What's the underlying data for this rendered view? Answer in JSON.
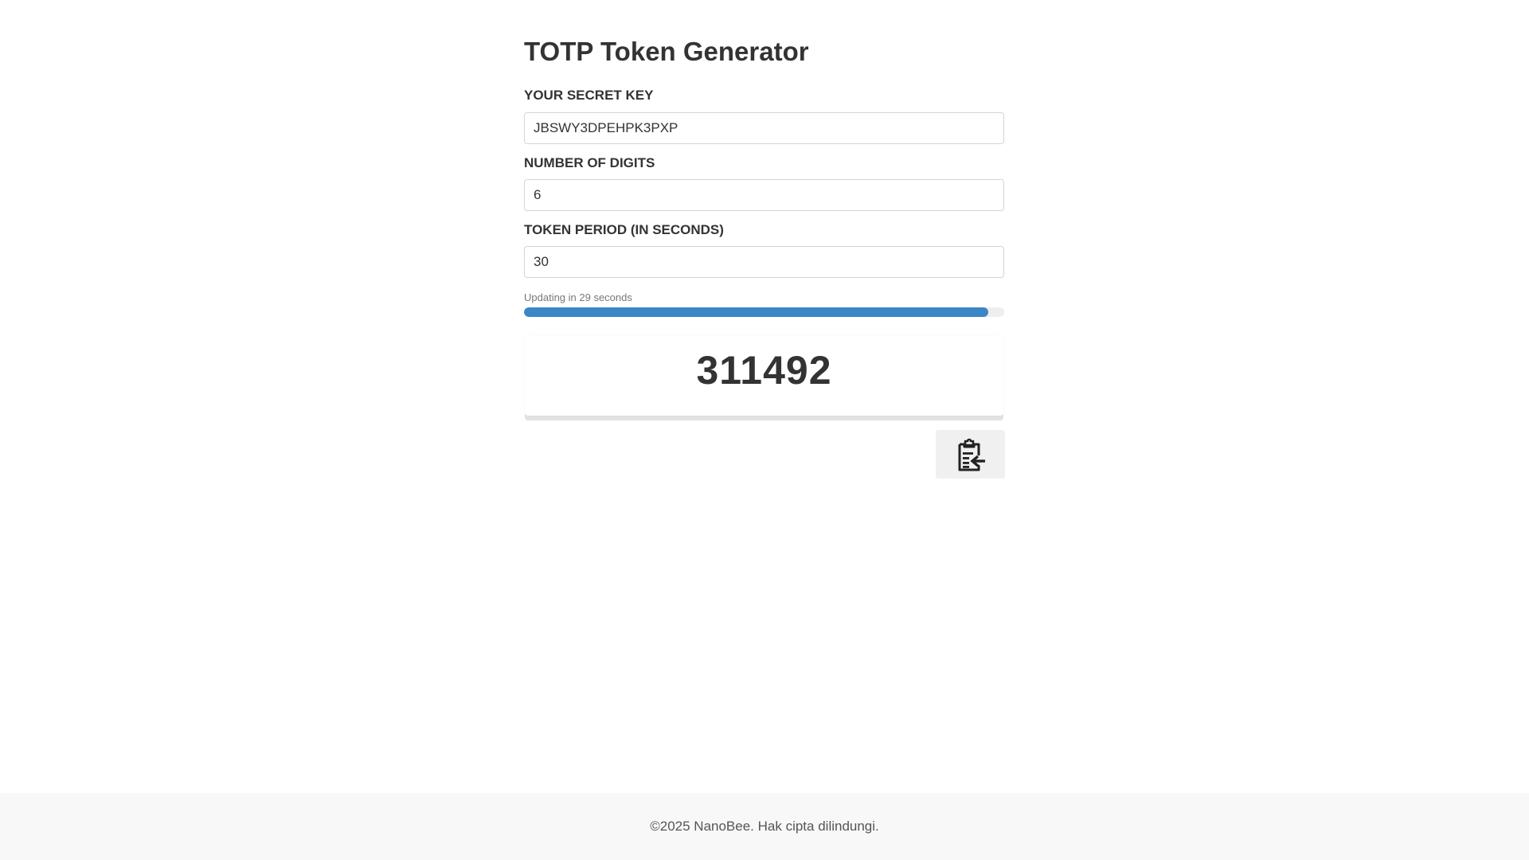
{
  "header": {
    "title": "TOTP Token Generator"
  },
  "form": {
    "secret_key": {
      "label": "YOUR SECRET KEY",
      "value": "JBSWY3DPEHPK3PXP"
    },
    "digits": {
      "label": "NUMBER OF DIGITS",
      "value": "6"
    },
    "period": {
      "label": "TOKEN PERIOD (IN SECONDS)",
      "value": "30"
    }
  },
  "countdown": {
    "text": "Updating in 29 seconds",
    "progress_percent": 96.67,
    "bar_color": "#3a87c8"
  },
  "token": {
    "value": "311492"
  },
  "copy_button": {
    "icon": "clipboard-paste-icon"
  },
  "footer": {
    "text": "©2025 NanoBee. Hak cipta dilindungi."
  }
}
